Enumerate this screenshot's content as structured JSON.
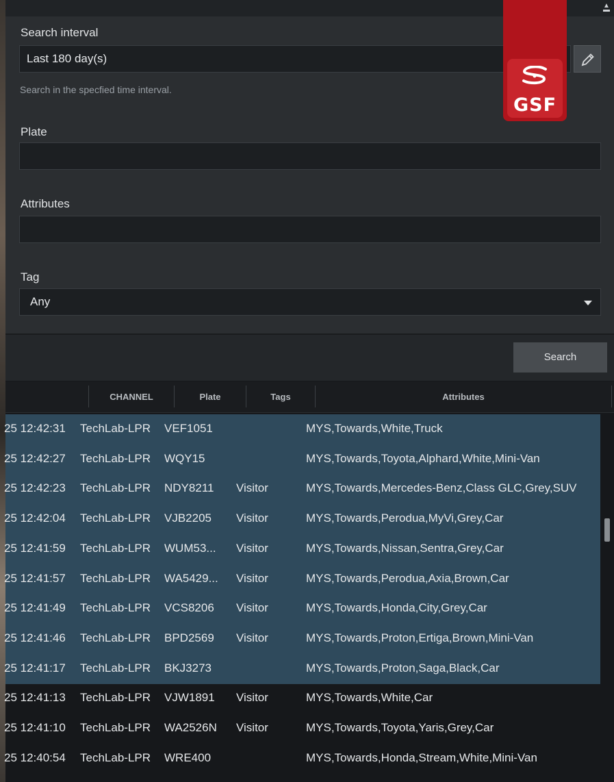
{
  "panel": {
    "search_interval_label": "Search interval",
    "search_interval_value": "Last 180 day(s)",
    "search_interval_hint": "Search in the specfied time interval.",
    "plate_label": "Plate",
    "plate_value": "",
    "attributes_label": "Attributes",
    "attributes_value": "",
    "tag_label": "Tag",
    "tag_value": "Any"
  },
  "logo": {
    "text": "GSF"
  },
  "search_button": "Search",
  "table": {
    "columns": [
      "CHANNEL",
      "Plate",
      "Tags",
      "Attributes"
    ],
    "rows": [
      {
        "time": "25 12:42:31",
        "channel": "TechLab-LPR",
        "plate": "VEF1051",
        "tags": "",
        "attributes": "MYS,Towards,White,Truck",
        "selected": true
      },
      {
        "time": "25 12:42:27",
        "channel": "TechLab-LPR",
        "plate": "WQY15",
        "tags": "",
        "attributes": "MYS,Towards,Toyota,Alphard,White,Mini-Van",
        "selected": true
      },
      {
        "time": "25 12:42:23",
        "channel": "TechLab-LPR",
        "plate": "NDY8211",
        "tags": "Visitor",
        "attributes": "MYS,Towards,Mercedes-Benz,Class GLC,Grey,SUV",
        "selected": true
      },
      {
        "time": "25 12:42:04",
        "channel": "TechLab-LPR",
        "plate": "VJB2205",
        "tags": "Visitor",
        "attributes": "MYS,Towards,Perodua,MyVi,Grey,Car",
        "selected": true
      },
      {
        "time": "25 12:41:59",
        "channel": "TechLab-LPR",
        "plate": "WUM53...",
        "tags": "Visitor",
        "attributes": "MYS,Towards,Nissan,Sentra,Grey,Car",
        "selected": true
      },
      {
        "time": "25 12:41:57",
        "channel": "TechLab-LPR",
        "plate": "WA5429...",
        "tags": "Visitor",
        "attributes": "MYS,Towards,Perodua,Axia,Brown,Car",
        "selected": true
      },
      {
        "time": "25 12:41:49",
        "channel": "TechLab-LPR",
        "plate": "VCS8206",
        "tags": "Visitor",
        "attributes": "MYS,Towards,Honda,City,Grey,Car",
        "selected": true
      },
      {
        "time": "25 12:41:46",
        "channel": "TechLab-LPR",
        "plate": "BPD2569",
        "tags": "Visitor",
        "attributes": "MYS,Towards,Proton,Ertiga,Brown,Mini-Van",
        "selected": true
      },
      {
        "time": "25 12:41:17",
        "channel": "TechLab-LPR",
        "plate": "BKJ3273",
        "tags": "",
        "attributes": "MYS,Towards,Proton,Saga,Black,Car",
        "selected": true
      },
      {
        "time": "25 12:41:13",
        "channel": "TechLab-LPR",
        "plate": "VJW1891",
        "tags": "Visitor",
        "attributes": "MYS,Towards,White,Car",
        "selected": false
      },
      {
        "time": "25 12:41:10",
        "channel": "TechLab-LPR",
        "plate": "WA2526N",
        "tags": "Visitor",
        "attributes": "MYS,Towards,Toyota,Yaris,Grey,Car",
        "selected": false
      },
      {
        "time": "25 12:40:54",
        "channel": "TechLab-LPR",
        "plate": "WRE400",
        "tags": "",
        "attributes": "MYS,Towards,Honda,Stream,White,Mini-Van",
        "selected": false
      }
    ]
  }
}
